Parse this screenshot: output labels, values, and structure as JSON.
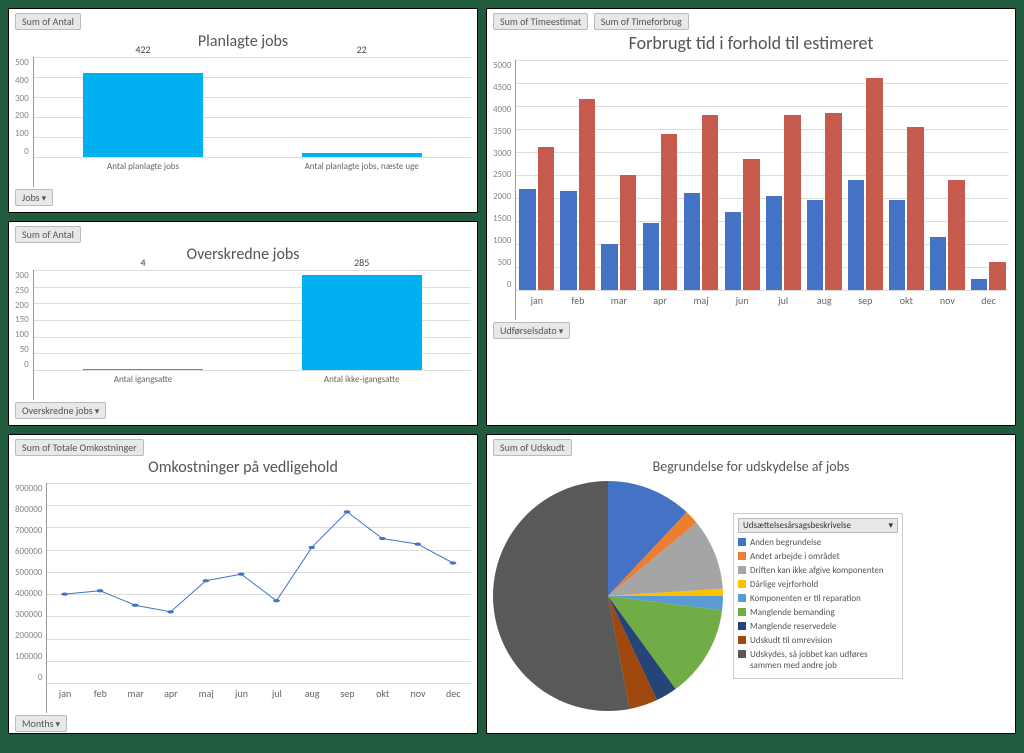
{
  "panels": {
    "planlagte": {
      "header_pill": "Sum of Antal",
      "title": "Planlagte jobs",
      "footer_filter": "Jobs"
    },
    "overskredne": {
      "header_pill": "Sum of Antal",
      "title": "Overskredne jobs",
      "footer_filter": "Overskredne jobs"
    },
    "forbrugt": {
      "header_pill1": "Sum of Timeestimat",
      "header_pill2": "Sum of Timeforbrug",
      "title": "Forbrugt tid i forhold til estimeret",
      "footer_filter": "Udførselsdato"
    },
    "omkostninger": {
      "header_pill": "Sum of Totale Omkostninger",
      "title": "Omkostninger på vedligehold",
      "footer_filter": "Months"
    },
    "begrundelse": {
      "header_pill": "Sum of Udskudt",
      "title": "Begrundelse for udskydelse af jobs",
      "legend_header": "Udsættelsesårsagsbeskrivelse"
    }
  },
  "chart_data": [
    {
      "id": "planlagte",
      "type": "bar",
      "title": "Planlagte jobs",
      "categories": [
        "Antal planlagte jobs",
        "Antal planlagte jobs, næste uge"
      ],
      "values": [
        422,
        22
      ],
      "yticks": [
        0,
        100,
        200,
        300,
        400,
        500
      ],
      "ylim": [
        0,
        500
      ],
      "color": "#00b0f0"
    },
    {
      "id": "overskredne",
      "type": "bar",
      "title": "Overskredne jobs",
      "categories": [
        "Antal igangsatte",
        "Antal ikke-igangsatte"
      ],
      "values": [
        4,
        285
      ],
      "yticks": [
        0,
        50,
        100,
        150,
        200,
        250,
        300
      ],
      "ylim": [
        0,
        300
      ],
      "color": "#00b0f0"
    },
    {
      "id": "forbrugt",
      "type": "bar",
      "title": "Forbrugt tid i forhold til estimeret",
      "categories": [
        "jan",
        "feb",
        "mar",
        "apr",
        "maj",
        "jun",
        "jul",
        "aug",
        "sep",
        "okt",
        "nov",
        "dec"
      ],
      "series": [
        {
          "name": "Sum of Timeestimat",
          "color": "#4472c4",
          "values": [
            2200,
            2150,
            1000,
            1450,
            2100,
            1700,
            2050,
            1950,
            2400,
            1950,
            1150,
            250
          ]
        },
        {
          "name": "Sum of Timeforbrug",
          "color": "#c55a4d",
          "values": [
            3100,
            4150,
            2500,
            3400,
            3800,
            2850,
            3800,
            3850,
            4600,
            3550,
            2400,
            600
          ]
        }
      ],
      "yticks": [
        0,
        500,
        1000,
        1500,
        2000,
        2500,
        3000,
        3500,
        4000,
        4500,
        5000
      ],
      "ylim": [
        0,
        5000
      ]
    },
    {
      "id": "omkostninger",
      "type": "line",
      "title": "Omkostninger på vedligehold",
      "categories": [
        "jan",
        "feb",
        "mar",
        "apr",
        "maj",
        "jun",
        "jul",
        "aug",
        "sep",
        "okt",
        "nov",
        "dec"
      ],
      "values": [
        400000,
        415000,
        350000,
        320000,
        460000,
        490000,
        370000,
        610000,
        770000,
        650000,
        625000,
        540000
      ],
      "yticks": [
        0,
        100000,
        200000,
        300000,
        400000,
        500000,
        600000,
        700000,
        800000,
        900000
      ],
      "ylim": [
        0,
        900000
      ],
      "color": "#4472c4"
    },
    {
      "id": "begrundelse",
      "type": "pie",
      "title": "Begrundelse for udskydelse af jobs",
      "slices": [
        {
          "label": "Anden begrundelse",
          "value": 12,
          "color": "#4472c4"
        },
        {
          "label": "Andet arbejde i området",
          "value": 2,
          "color": "#ed7d31"
        },
        {
          "label": "Driften kan ikke afgive komponenten",
          "value": 10,
          "color": "#a5a5a5"
        },
        {
          "label": "Dårlige vejrforhold",
          "value": 1,
          "color": "#ffc000"
        },
        {
          "label": "Komponenten er til reparation",
          "value": 2,
          "color": "#5b9bd5"
        },
        {
          "label": "Manglende bemanding",
          "value": 13,
          "color": "#70ad47"
        },
        {
          "label": "Manglende reservedele",
          "value": 3,
          "color": "#264478"
        },
        {
          "label": "Udskudt til omrevision",
          "value": 4,
          "color": "#9e480e"
        },
        {
          "label": "Udskydes, så jobbet kan udføres sammen med andre job",
          "value": 53,
          "color": "#595959"
        }
      ]
    }
  ]
}
